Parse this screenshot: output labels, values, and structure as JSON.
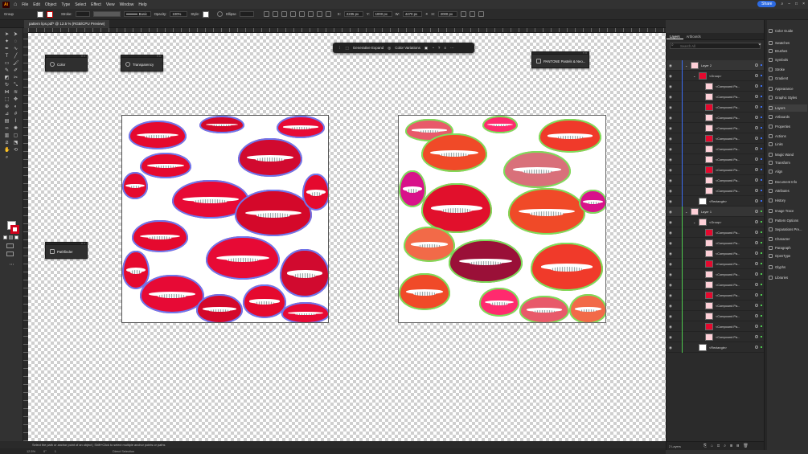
{
  "menubar": {
    "logo": "Ai",
    "items": [
      "File",
      "Edit",
      "Object",
      "Type",
      "Select",
      "Effect",
      "View",
      "Window",
      "Help"
    ],
    "share_label": "Share"
  },
  "control": {
    "selection_label": "Group",
    "stroke_label": "Stroke:",
    "brush_label": "Basic",
    "opacity_label": "Opacity:",
    "opacity_value": "100%",
    "style_label": "Style:",
    "shape_label": "Ellipse",
    "x_label": "X:",
    "x_value": "2235 px",
    "y_label": "Y:",
    "y_value": "1000 px",
    "w_label": "W:",
    "w_value": "4470 px",
    "h_label": "H:",
    "h_value": "2000 px"
  },
  "document_tab": "pattern lips.pdf* @ 12.5 % (RGB/CPU Preview)",
  "floating_panels": {
    "color": "Color",
    "transparency": "Transparency",
    "pathfinder": "Pathfinder",
    "pantone": "PANTONE Pastels & Neo..."
  },
  "context_bar": {
    "generative_expand": "Generative Expand",
    "color_variations": "Color Variations"
  },
  "layers_panel": {
    "tabs": [
      "Layers",
      "Artboards"
    ],
    "search_placeholder": "Search All",
    "rows": [
      {
        "name": "Layer 2",
        "kind": "layer"
      },
      {
        "name": "<Group>",
        "kind": "group"
      },
      {
        "name": "<Compound Pa...",
        "kind": "item"
      },
      {
        "name": "<Compound Pa...",
        "kind": "item"
      },
      {
        "name": "<Compound Pa...",
        "kind": "item"
      },
      {
        "name": "<Compound Pa...",
        "kind": "item"
      },
      {
        "name": "<Compound Pa...",
        "kind": "item"
      },
      {
        "name": "<Compound Pa...",
        "kind": "item"
      },
      {
        "name": "<Compound Pa...",
        "kind": "item"
      },
      {
        "name": "<Compound Pa...",
        "kind": "item"
      },
      {
        "name": "<Compound Pa...",
        "kind": "item"
      },
      {
        "name": "<Compound Pa...",
        "kind": "item"
      },
      {
        "name": "<Compound Pa...",
        "kind": "item"
      },
      {
        "name": "<Rectangle>",
        "kind": "rect"
      },
      {
        "name": "Layer 1",
        "kind": "layer"
      },
      {
        "name": "<Group>",
        "kind": "group"
      },
      {
        "name": "<Compound Pa...",
        "kind": "item"
      },
      {
        "name": "<Compound Pa...",
        "kind": "item"
      },
      {
        "name": "<Compound Pa...",
        "kind": "item"
      },
      {
        "name": "<Compound Pa...",
        "kind": "item"
      },
      {
        "name": "<Compound Pa...",
        "kind": "item"
      },
      {
        "name": "<Compound Pa...",
        "kind": "item"
      },
      {
        "name": "<Compound Pa...",
        "kind": "item"
      },
      {
        "name": "<Compound Pa...",
        "kind": "item"
      },
      {
        "name": "<Compound Pa...",
        "kind": "item"
      },
      {
        "name": "<Compound Pa...",
        "kind": "item"
      },
      {
        "name": "<Compound Pa...",
        "kind": "item"
      },
      {
        "name": "<Rectangle>",
        "kind": "rect"
      }
    ],
    "footer": "2 Layers"
  },
  "dock": {
    "items": [
      "Color Guide",
      "Swatches",
      "Brushes",
      "Symbols",
      "Stroke",
      "Gradient",
      "Appearance",
      "Graphic Styles",
      "Layers",
      "Artboards",
      "Properties",
      "Actions",
      "Links",
      "Magic Wand",
      "Transform",
      "Align",
      "Document Info",
      "Attributes",
      "History",
      "Image Trace",
      "Pattern Options",
      "Separations Pre...",
      "Character",
      "Paragraph",
      "OpenType",
      "Glyphs",
      "Libraries"
    ]
  },
  "status": {
    "hint": "Select the path or anchor point of an object  |  Shift+Click to select multiple anchor points or paths",
    "zoom": "12.5%",
    "rotation": "0°",
    "artboard_num": "1",
    "tool_name": "Direct Selection"
  },
  "colors": {
    "layer2": "#3b6df0",
    "layer1": "#4ec94e",
    "accent": "#2d6ae0"
  }
}
